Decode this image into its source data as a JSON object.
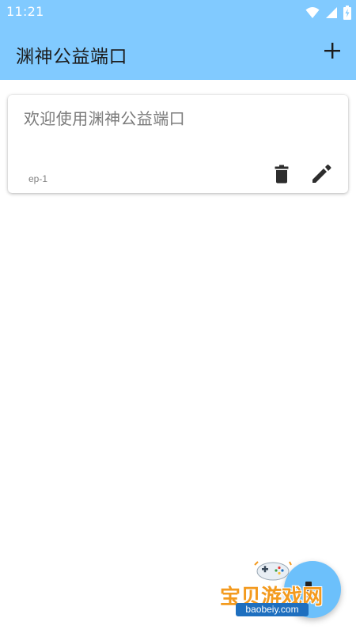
{
  "status_bar": {
    "time": "11:21",
    "icons": [
      "wifi-icon",
      "cellular-signal-icon",
      "battery-charging-icon"
    ]
  },
  "app_bar": {
    "title": "渊神公益端口",
    "add_icon": "plus-icon"
  },
  "cards": [
    {
      "title": "欢迎使用渊神公益端口",
      "id_label": "ep-1",
      "actions": [
        "trash-icon",
        "pencil-icon"
      ]
    }
  ],
  "watermark": {
    "text": "宝贝游戏网",
    "domain": "baobeiy.com"
  },
  "colors": {
    "app_bar": "#81caff",
    "fab": "#6cc0fb",
    "card_title": "#7a7a7a",
    "watermark_orange": "#f39a1e",
    "watermark_blue": "#1e6fbf"
  }
}
